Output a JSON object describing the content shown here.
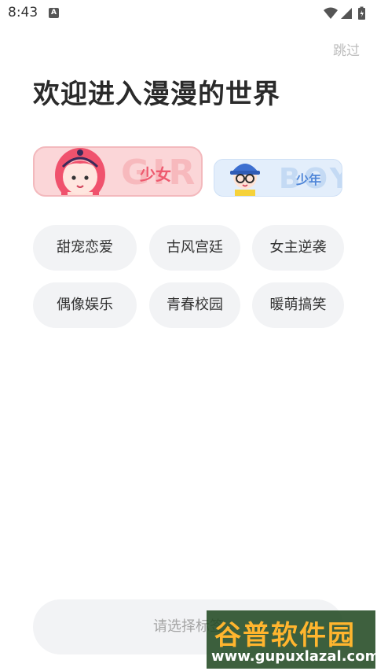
{
  "status_bar": {
    "time": "8:43",
    "notif_letter": "A"
  },
  "header": {
    "skip_label": "跳过",
    "title": "欢迎进入漫漫的世界"
  },
  "gender": {
    "girl": {
      "label": "少女",
      "bg_word": "GIRL"
    },
    "boy": {
      "label": "少年",
      "bg_word": "BOY"
    }
  },
  "tags": [
    "甜宠恋爱",
    "古风宫廷",
    "女主逆袭",
    "偶像娱乐",
    "青春校园",
    "暖萌搞笑"
  ],
  "bottom": {
    "button_label": "请选择标签"
  },
  "watermark": {
    "title": "谷普软件园",
    "url": "www.gupuxlazal.com"
  },
  "colors": {
    "girl_accent": "#ee5a6f",
    "boy_accent": "#4f86d8",
    "tag_bg": "#f2f3f5",
    "skip_text": "#bdbdbd"
  }
}
